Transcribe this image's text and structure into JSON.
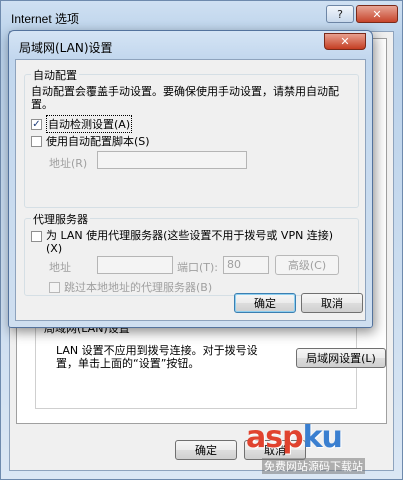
{
  "outer_window": {
    "title": "Internet 选项",
    "help_button": "?",
    "close_button": "✕",
    "lan_group_title": "局域网(LAN)设置",
    "lan_description": "LAN 设置不应用到拨号连接。对于拨号设置，单击上面的“设置”按钮。",
    "lan_settings_button": "局域网设置(L)",
    "ok_button": "确定",
    "cancel_button": "取消"
  },
  "dialog": {
    "title": "局域网(LAN)设置",
    "close_button": "✕",
    "auto_config": {
      "group_title": "自动配置",
      "description": "自动配置会覆盖手动设置。要确保使用手动设置，请禁用自动配置。",
      "auto_detect_label": "自动检测设置(A)",
      "auto_detect_checked": true,
      "use_script_label": "使用自动配置脚本(S)",
      "use_script_checked": false,
      "address_label": "地址(R)",
      "address_value": ""
    },
    "proxy": {
      "group_title": "代理服务器",
      "use_proxy_label": "为 LAN 使用代理服务器(这些设置不用于拨号或 VPN 连接)(X)",
      "use_proxy_checked": false,
      "address_label": "地址",
      "address_value": "",
      "port_label": "端口(T):",
      "port_value": "80",
      "advanced_button": "高级(C)",
      "bypass_local_label": "跳过本地地址的代理服务器(B)",
      "bypass_local_checked": false
    },
    "ok_button": "确定",
    "cancel_button": "取消"
  },
  "watermark": {
    "brand_part1": "asp",
    "brand_part2": "ku",
    "subtitle": "免费网站源码下载站"
  },
  "colors": {
    "title_bar": "#c2d7ee",
    "close_button": "#c43d22",
    "default_button_border": "#3c7fb1",
    "check_mark": "#1f3d7a",
    "watermark_red": "#e0432f",
    "watermark_blue": "#3a7fd0"
  }
}
